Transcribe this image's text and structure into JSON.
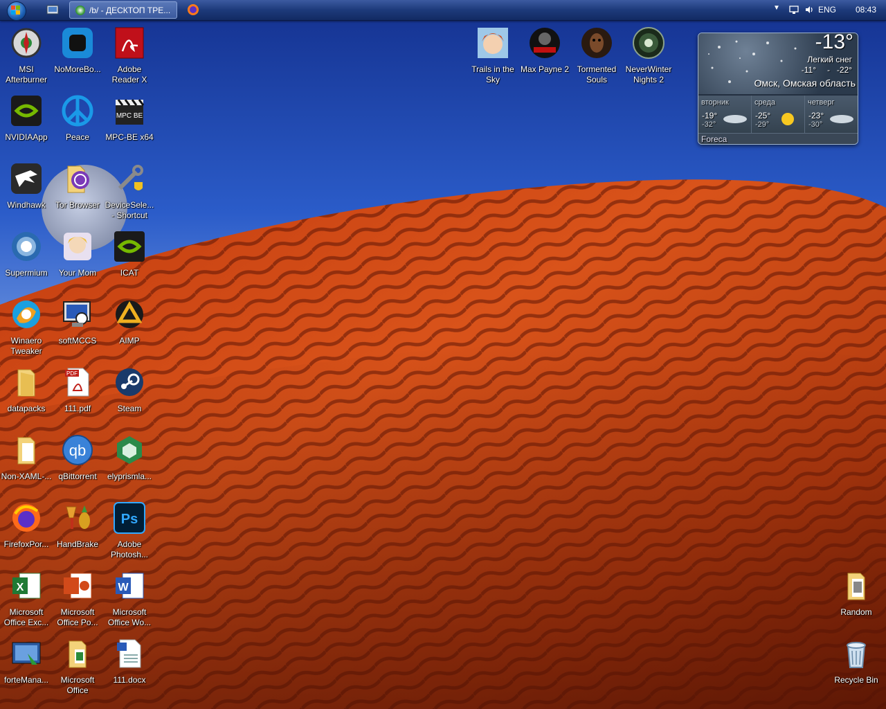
{
  "taskbar": {
    "window_title": "/b/ - ДЕСКТОП ТРЕ...",
    "tray_language": "ENG",
    "tray_time": "08:43"
  },
  "desktop_icons": {
    "msi": "MSI Afterburner",
    "nomorebo": "NoMoreBo...",
    "adobe_reader": "Adobe Reader X",
    "nvidia_app": "NVIDIAApp",
    "peace": "Peace",
    "mpcbe": "MPC-BE x64",
    "windhawk": "Windhawk",
    "tor": "Tor Browser",
    "devicesele": "DeviceSele... - Shortcut",
    "supermium": "Supermium",
    "yourmom": "Your Mom",
    "icat": "ICAT",
    "winaero": "Winaero Tweaker",
    "softmccs": "softMCCS",
    "aimp": "AIMP",
    "datapacks": "datapacks",
    "pdf111": "111.pdf",
    "steam": "Steam",
    "nonxaml": "Non-XAML-...",
    "qbittorrent": "qBittorrent",
    "elyprism": "elyprismla...",
    "firefoxpor": "FirefoxPor...",
    "handbrake": "HandBrake",
    "photoshop": "Adobe Photosh...",
    "excel": "Microsoft Office Exc...",
    "powerpoint": "Microsoft Office Po...",
    "word": "Microsoft Office Wo...",
    "fortemana": "forteMana...",
    "msoffice": "Microsoft Office",
    "docx111": "111.docx",
    "trails": "Trails in the Sky",
    "maxpayne": "Max Payne 2",
    "tormented": "Tormented Souls",
    "neverwinter": "NeverWinter Nights 2",
    "random": "Random",
    "recycle": "Recycle Bin"
  },
  "weather": {
    "temp": "-13°",
    "condition": "Легкий снег",
    "range_high": "-11°",
    "range_sep": "-",
    "range_low": "-22°",
    "location": "Омск, Омская область",
    "days": [
      {
        "name": "вторник",
        "high": "-19°",
        "low": "-32°"
      },
      {
        "name": "среда",
        "high": "-25°",
        "low": "-29°"
      },
      {
        "name": "четверг",
        "high": "-23°",
        "low": "-30°"
      }
    ],
    "provider": "Foreca"
  },
  "colors": {
    "sky_top": "#1d3fa6",
    "sky_horizon": "#6f98e0",
    "dune_light": "#e0561a",
    "dune_dark": "#7a1f06"
  }
}
